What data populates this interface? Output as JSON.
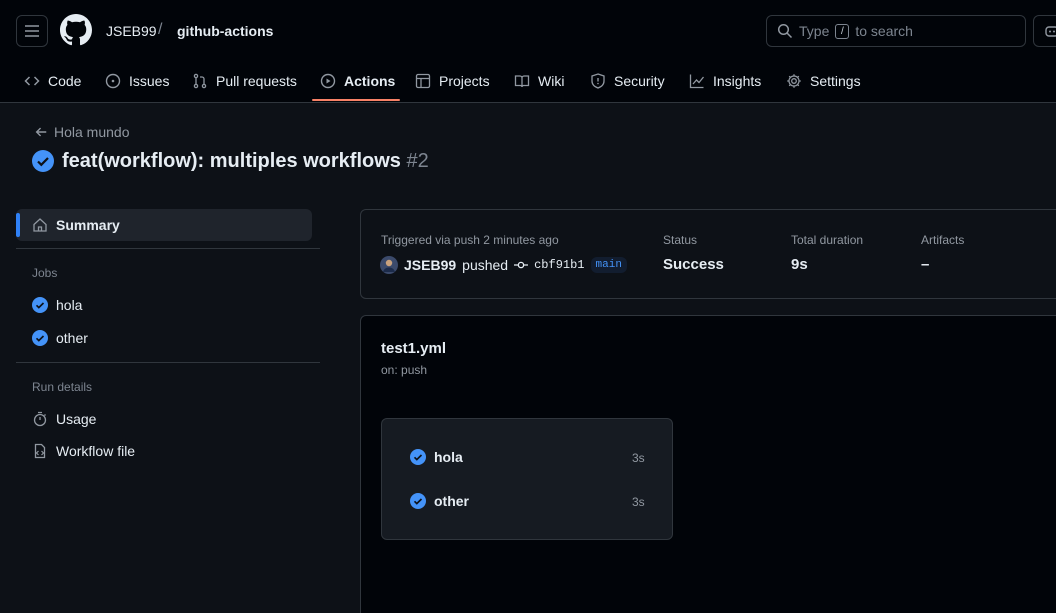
{
  "header": {
    "owner": "JSEB99",
    "separator": "/",
    "repo": "github-actions",
    "search_prefix": "Type",
    "search_key": "/",
    "search_suffix": "to search"
  },
  "tabs": [
    {
      "label": "Code",
      "icon": "code-icon"
    },
    {
      "label": "Issues",
      "icon": "issue-icon"
    },
    {
      "label": "Pull requests",
      "icon": "pull-request-icon"
    },
    {
      "label": "Actions",
      "icon": "play-icon",
      "active": true
    },
    {
      "label": "Projects",
      "icon": "table-icon"
    },
    {
      "label": "Wiki",
      "icon": "book-icon"
    },
    {
      "label": "Security",
      "icon": "shield-icon"
    },
    {
      "label": "Insights",
      "icon": "graph-icon"
    },
    {
      "label": "Settings",
      "icon": "gear-icon"
    }
  ],
  "run": {
    "back_label": "Hola mundo",
    "title": "feat(workflow): multiples workflows",
    "number": "#2"
  },
  "sidebar": {
    "summary": "Summary",
    "jobs_heading": "Jobs",
    "jobs": [
      "hola",
      "other"
    ],
    "details_heading": "Run details",
    "details": [
      "Usage",
      "Workflow file"
    ]
  },
  "summary": {
    "trigger": "Triggered via push 2 minutes ago",
    "actor": "JSEB99",
    "action": "pushed",
    "commit": "cbf91b1",
    "branch": "main",
    "status_label": "Status",
    "status_value": "Success",
    "duration_label": "Total duration",
    "duration_value": "9s",
    "artifacts_label": "Artifacts",
    "artifacts_value": "–"
  },
  "workflow": {
    "file": "test1.yml",
    "event": "on: push",
    "jobs": [
      {
        "name": "hola",
        "duration": "3s"
      },
      {
        "name": "other",
        "duration": "3s"
      }
    ]
  },
  "colors": {
    "accent": "#2f81f7",
    "success": "#4493f8",
    "tab_underline": "#f78166",
    "background": "#0d1117"
  }
}
